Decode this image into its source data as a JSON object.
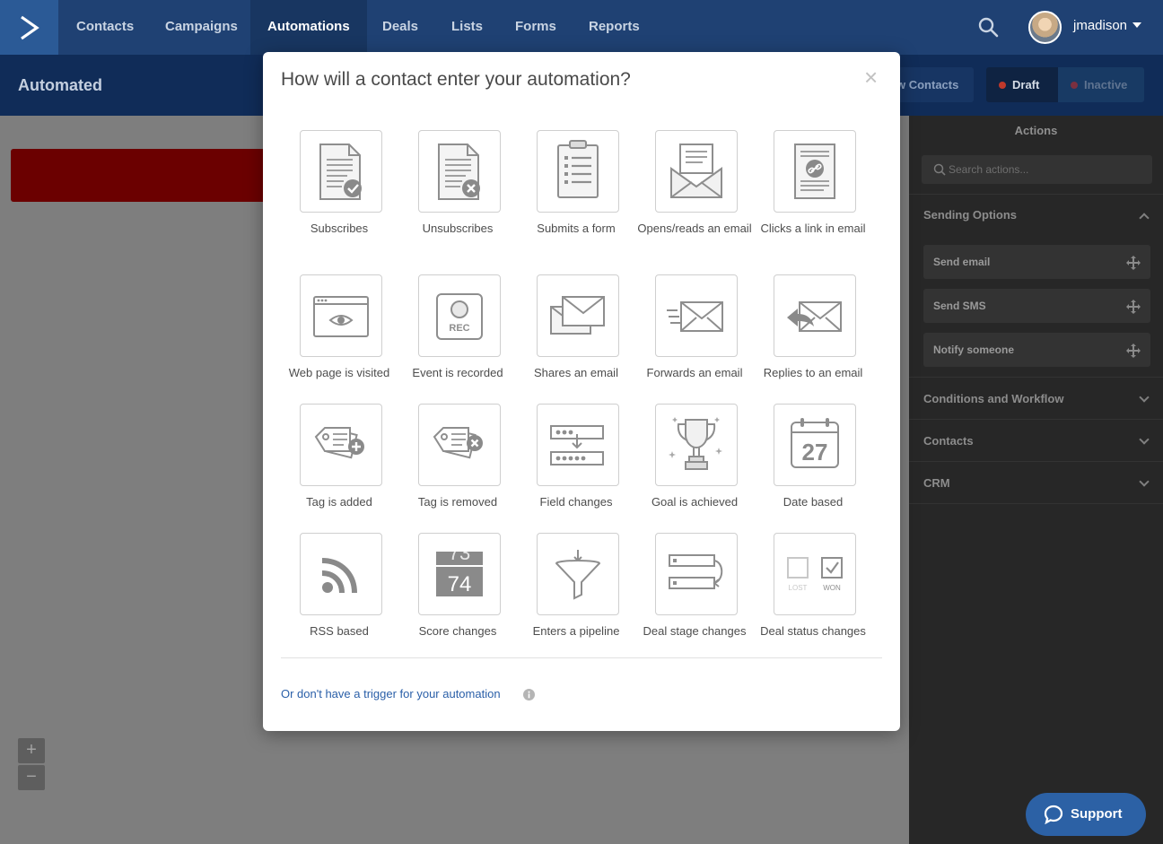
{
  "topnav": {
    "items": [
      "Contacts",
      "Campaigns",
      "Automations",
      "Deals",
      "Lists",
      "Forms",
      "Reports"
    ],
    "active_index": 2,
    "username": "jmadison"
  },
  "subheader": {
    "title": "Automated",
    "contacts_button": "w Contacts",
    "draft_button": "Draft",
    "inactive_button": "Inactive"
  },
  "sidebar": {
    "title": "Actions",
    "search_placeholder": "Search actions...",
    "sections": [
      {
        "label": "Sending Options",
        "expanded": true,
        "items": [
          "Send email",
          "Send SMS",
          "Notify someone"
        ]
      },
      {
        "label": "Conditions and Workflow",
        "expanded": false
      },
      {
        "label": "Contacts",
        "expanded": false
      },
      {
        "label": "CRM",
        "expanded": false
      }
    ]
  },
  "modal": {
    "title": "How will a contact enter your automation?",
    "close_glyph": "×",
    "triggers": [
      {
        "label": "Subscribes",
        "icon": "subscribe-document-icon"
      },
      {
        "label": "Unsubscribes",
        "icon": "unsubscribe-document-icon"
      },
      {
        "label": "Submits a form",
        "icon": "clipboard-form-icon"
      },
      {
        "label": "Opens/reads an email",
        "icon": "open-envelope-icon"
      },
      {
        "label": "Clicks a link in email",
        "icon": "link-document-icon"
      },
      {
        "label": "Web page is visited",
        "icon": "browser-eye-icon"
      },
      {
        "label": "Event is recorded",
        "icon": "record-event-icon",
        "icon_text": "REC"
      },
      {
        "label": "Shares an email",
        "icon": "share-envelopes-icon"
      },
      {
        "label": "Forwards an email",
        "icon": "forward-envelope-icon"
      },
      {
        "label": "Replies to an email",
        "icon": "reply-envelope-icon"
      },
      {
        "label": "Tag is added",
        "icon": "tag-add-icon"
      },
      {
        "label": "Tag is removed",
        "icon": "tag-remove-icon"
      },
      {
        "label": "Field changes",
        "icon": "field-change-icon"
      },
      {
        "label": "Goal is achieved",
        "icon": "trophy-icon"
      },
      {
        "label": "Date based",
        "icon": "calendar-icon",
        "icon_text": "27"
      },
      {
        "label": "RSS based",
        "icon": "rss-icon"
      },
      {
        "label": "Score changes",
        "icon": "score-counter-icon",
        "icon_text_top": "73",
        "icon_text": "74"
      },
      {
        "label": "Enters a pipeline",
        "icon": "funnel-icon"
      },
      {
        "label": "Deal stage changes",
        "icon": "deal-stage-icon"
      },
      {
        "label": "Deal status changes",
        "icon": "deal-status-icon",
        "icon_text_lost": "LOST",
        "icon_text_won": "WON"
      }
    ],
    "no_trigger_link": "Or don't have a trigger for your automation"
  },
  "support": {
    "label": "Support"
  },
  "zoom": {
    "in": "+",
    "out": "−"
  },
  "colors": {
    "nav_bg": "#1f4173",
    "subheader_bg": "#102c58",
    "sidebar_bg": "#272727",
    "link": "#2a5fa8",
    "support_bg": "#2c61a5",
    "draft_dot": "#c0392b"
  }
}
